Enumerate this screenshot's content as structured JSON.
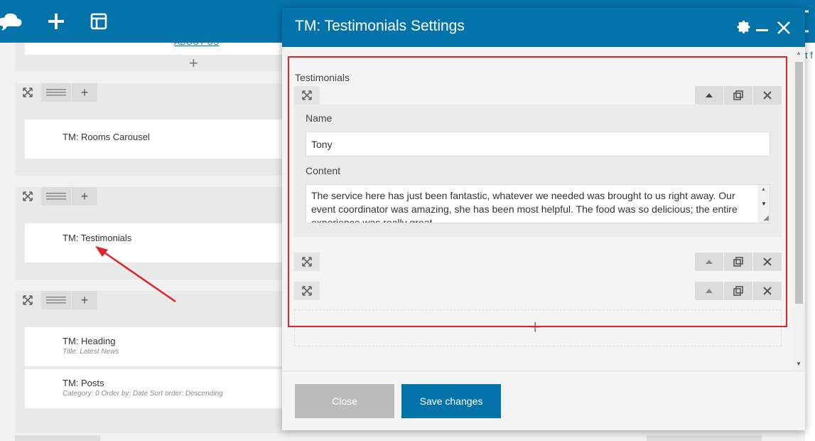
{
  "toolbar": {
    "logo_icon": "cloud-logo-icon",
    "add_icon": "plus-icon",
    "layout_icon": "layout-icon",
    "accent": "#0473aa"
  },
  "builder": {
    "about_link": "ABOUT US",
    "elements": [
      {
        "title": "TM: Rooms Carousel"
      },
      {
        "title": "TM: Testimonials"
      },
      {
        "title": "TM: Heading",
        "subtitle": "Title: Latest News"
      },
      {
        "title": "TM: Posts",
        "subtitle": "Category: 0  Order by: Date  Sort order: Descending"
      }
    ],
    "right_link": "t f"
  },
  "modal": {
    "title": "TM: Testimonials Settings",
    "section_label": "Testimonials",
    "name_label": "Name",
    "name_value": "Tony",
    "content_label": "Content",
    "content_value": "The service here has just been fantastic, whatever we needed was brought to us right away. Our event coordinator was amazing, she has been most helpful. The food was so delicious; the entire experience was really great.",
    "highlight_color": "#e32227",
    "close_label": "Close",
    "save_label": "Save changes"
  }
}
